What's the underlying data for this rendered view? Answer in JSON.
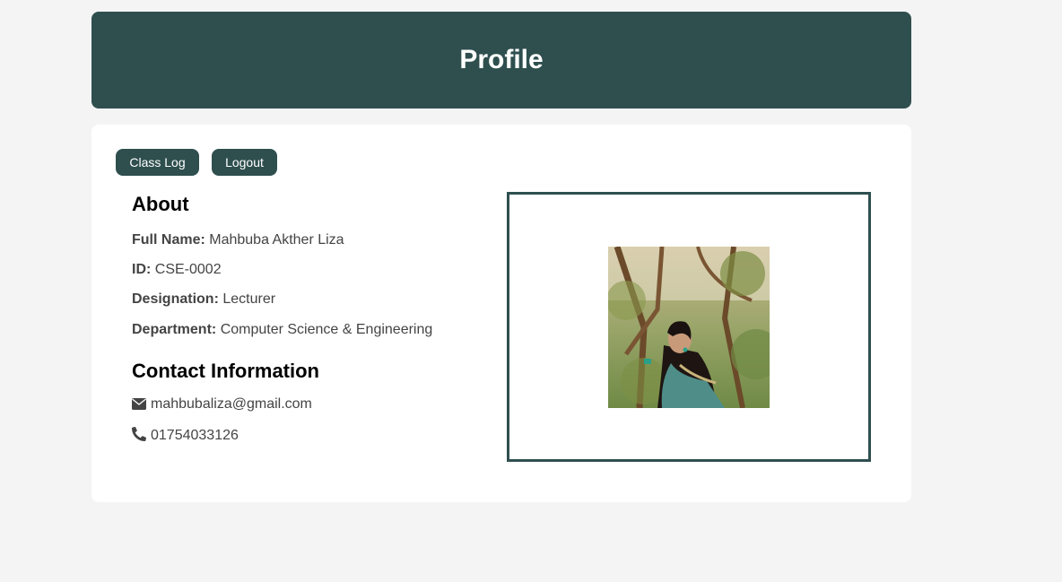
{
  "header": {
    "title": "Profile"
  },
  "nav": {
    "class_log_label": "Class Log",
    "logout_label": "Logout"
  },
  "about": {
    "heading": "About",
    "full_name_label": "Full Name:",
    "full_name": "Mahbuba Akther Liza",
    "id_label": "ID:",
    "id": "CSE-0002",
    "designation_label": "Designation:",
    "designation": "Lecturer",
    "department_label": "Department:",
    "department": "Computer Science & Engineering"
  },
  "contact": {
    "heading": "Contact Information",
    "email": "mahbubaliza@gmail.com",
    "email_icon": "envelope-icon",
    "phone": "01754033126",
    "phone_icon": "phone-icon"
  },
  "colors": {
    "accent": "#2f4f4f",
    "background": "#f4f4f4"
  }
}
